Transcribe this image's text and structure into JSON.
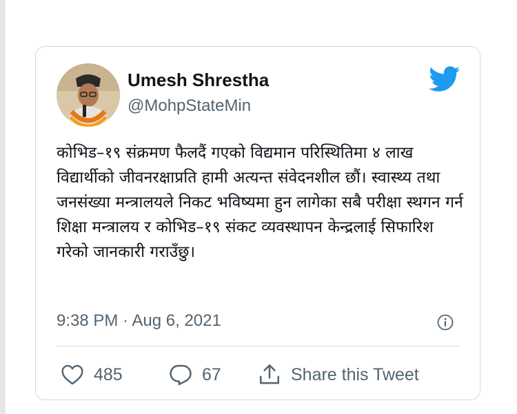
{
  "author": {
    "display_name": "Umesh Shrestha",
    "handle": "@MohpStateMin"
  },
  "tweet": {
    "text": "कोभिड–१९ संक्रमण फैलदैं गएको विद्यमान परिस्थितिमा ४ लाख विद्यार्थीको जीवनरक्षाप्रति हामी अत्यन्त संवेदनशील छौं। स्वास्थ्य तथा जनसंख्या मन्त्रालयले निकट भविष्यमा हुन लागेका सबै परीक्षा स्थगन गर्न शिक्षा मन्त्रालय र कोभिड–१९ संकट व्यवस्थापन केन्द्रलाई सिफारिश गरेको जानकारी गराउँछु।",
    "timestamp": "9:38 PM · Aug 6, 2021"
  },
  "actions": {
    "likes": "485",
    "replies": "67",
    "share_label": "Share this Tweet"
  },
  "icons": {
    "brand": "twitter-bird-icon",
    "info": "info-icon",
    "like": "heart-icon",
    "reply": "reply-bubble-icon",
    "share": "share-upload-icon"
  },
  "colors": {
    "brand_blue": "#1d9bf0",
    "text_primary": "#0f1419",
    "text_secondary": "#536471",
    "border": "#cfd9de"
  }
}
